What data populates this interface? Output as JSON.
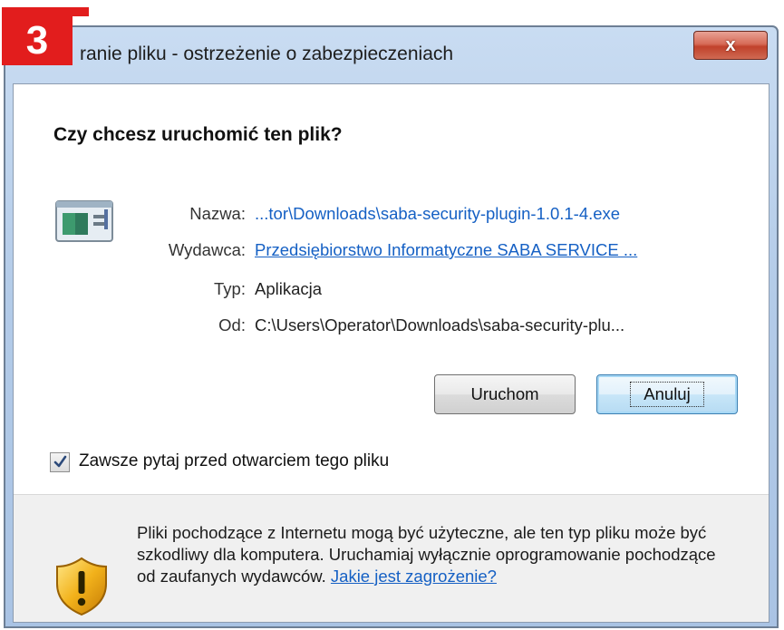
{
  "step_badge": "3",
  "window": {
    "title": "ranie pliku - ostrzeżenie o zabezpieczeniach",
    "close_symbol": "x"
  },
  "dialog": {
    "question": "Czy chcesz uruchomić ten plik?",
    "file_icon": "application-window-icon",
    "fields": [
      {
        "label": "Nazwa:",
        "value": "...tor\\Downloads\\saba-security-plugin-1.0.1-4.exe"
      },
      {
        "label": "Wydawca:",
        "value": "Przedsiębiorstwo Informatyczne SABA SERVICE ..."
      },
      {
        "label": "Typ:",
        "value": "Aplikacja"
      },
      {
        "label": "Od:",
        "value": "C:\\Users\\Operator\\Downloads\\saba-security-plu..."
      }
    ],
    "buttons": {
      "run": "Uruchom",
      "cancel": "Anuluj"
    },
    "checkbox": {
      "label": "Zawsze pytaj przed otwarciem tego pliku",
      "checked": true
    }
  },
  "warning": {
    "icon": "shield-warning-icon",
    "text": "Pliki pochodzące z Internetu mogą być użyteczne, ale ten typ pliku może być szkodliwy dla komputera. Uruchamiaj wyłącznie oprogramowanie pochodzące od zaufanych wydawców.",
    "link": "Jakie jest zagrożenie?"
  },
  "colors": {
    "link": "#1560c4",
    "badge": "#e21d1d",
    "close": "#c1412b"
  }
}
